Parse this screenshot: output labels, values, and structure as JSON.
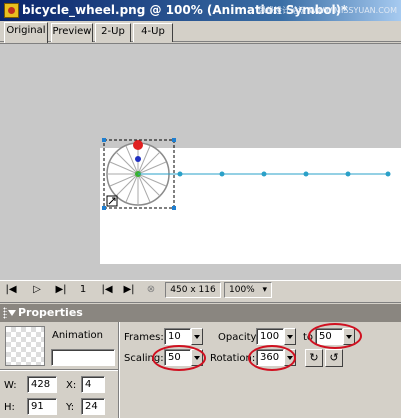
{
  "window": {
    "title": "bicycle_wheel.png @ 100% (Animation Symbol)*",
    "watermark": "思缘设计论坛 WWW.MISSYUAN.COM",
    "icon": "fireworks-document-icon"
  },
  "tabs": [
    {
      "label": "Original",
      "active": true
    },
    {
      "label": "Preview",
      "active": false
    },
    {
      "label": "2-Up",
      "active": false
    },
    {
      "label": "4-Up",
      "active": false
    }
  ],
  "playback": {
    "frame": "1",
    "canvas_size": "450 x 116",
    "zoom": "100%",
    "icons": [
      "first-frame-icon",
      "play-icon",
      "next-frame-icon",
      "last-frame-icon",
      "stop-icon"
    ]
  },
  "properties": {
    "header": "Properties",
    "object_type": "Animation",
    "name_value": "",
    "w_label": "W:",
    "w_value": "428",
    "x_label": "X:",
    "x_value": "4",
    "h_label": "H:",
    "h_value": "91",
    "y_label": "Y:",
    "y_value": "24",
    "frames_label": "Frames:",
    "frames_value": "10",
    "opacity_label": "Opacity:",
    "opacity_value": "100",
    "to_label": "to",
    "to_value": "50",
    "scaling_label": "Scaling:",
    "scaling_value": "50",
    "rotation_label": "Rotation:",
    "rotation_value": "360",
    "rotate_cw_icon": "rotate-clockwise-icon",
    "rotate_ccw_icon": "rotate-counterclockwise-icon"
  },
  "colors": {
    "highlight_ring": "#d01020",
    "motion_path": "#2aa0c8",
    "selection_handle": "#1f7fd0"
  }
}
